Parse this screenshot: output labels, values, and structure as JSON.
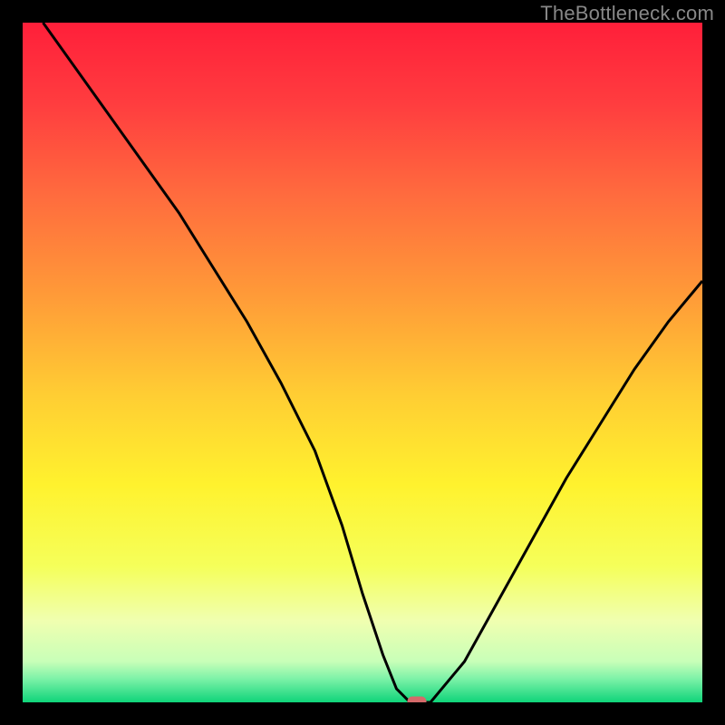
{
  "watermark": "TheBottleneck.com",
  "chart_data": {
    "type": "line",
    "title": "",
    "xlabel": "",
    "ylabel": "",
    "xlim": [
      0,
      100
    ],
    "ylim": [
      0,
      100
    ],
    "background_gradient": {
      "stops": [
        {
          "offset": 0.0,
          "color": "#ff1f3a"
        },
        {
          "offset": 0.12,
          "color": "#ff3d3f"
        },
        {
          "offset": 0.25,
          "color": "#ff6a3e"
        },
        {
          "offset": 0.4,
          "color": "#ff9a38"
        },
        {
          "offset": 0.55,
          "color": "#ffce33"
        },
        {
          "offset": 0.68,
          "color": "#fff22e"
        },
        {
          "offset": 0.8,
          "color": "#f5ff5a"
        },
        {
          "offset": 0.88,
          "color": "#f0ffb0"
        },
        {
          "offset": 0.94,
          "color": "#c8ffb8"
        },
        {
          "offset": 0.965,
          "color": "#7ef2a8"
        },
        {
          "offset": 1.0,
          "color": "#0fd47a"
        }
      ]
    },
    "series": [
      {
        "name": "bottleneck-curve",
        "color": "#000000",
        "x": [
          3,
          8,
          13,
          18,
          23,
          28,
          33,
          38,
          43,
          47,
          50,
          53,
          55,
          57,
          60,
          65,
          70,
          75,
          80,
          85,
          90,
          95,
          100
        ],
        "y": [
          100,
          93,
          86,
          79,
          72,
          64,
          56,
          47,
          37,
          26,
          16,
          7,
          2,
          0,
          0,
          6,
          15,
          24,
          33,
          41,
          49,
          56,
          62
        ]
      }
    ],
    "marker": {
      "x": 58,
      "y": 0,
      "color": "#d46a6a",
      "shape": "rounded-rect"
    }
  }
}
